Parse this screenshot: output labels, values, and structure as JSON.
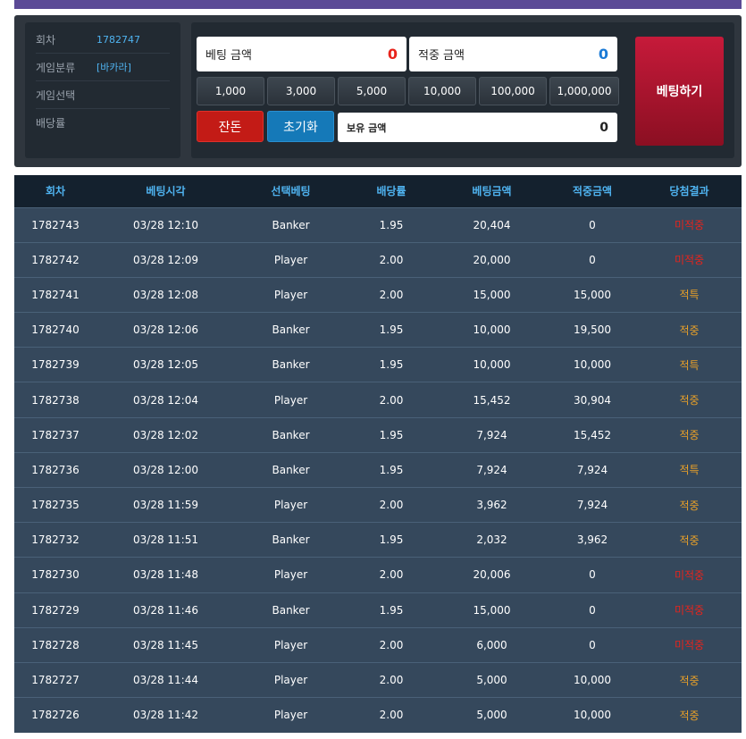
{
  "info": {
    "round_label": "회차",
    "round_value": "1782747",
    "category_label": "게임분류",
    "category_value": "[바카라]",
    "select_label": "게임선택",
    "select_value": "",
    "odds_label": "배당률",
    "odds_value": ""
  },
  "bet": {
    "bet_amount_label": "베팅 금액",
    "bet_amount_value": "0",
    "win_amount_label": "적중 금액",
    "win_amount_value": "0",
    "chips": [
      "1,000",
      "3,000",
      "5,000",
      "10,000",
      "100,000",
      "1,000,000"
    ],
    "balance_button": "잔돈",
    "reset_button": "초기화",
    "hold_label": "보유 금액",
    "hold_value": "0",
    "bet_button": "베팅하기"
  },
  "colors": {
    "accent_blue": "#4fb3f0",
    "miss_red": "#e8241c",
    "hit_orange": "#e8a028",
    "bet_button": "#a8132e"
  },
  "history": {
    "headers": [
      "회차",
      "베팅시각",
      "선택베팅",
      "배당률",
      "베팅금액",
      "적중금액",
      "당첨결과"
    ],
    "rows": [
      [
        "1782743",
        "03/28 12:10",
        "Banker",
        "1.95",
        "20,404",
        "0",
        "미적중"
      ],
      [
        "1782742",
        "03/28 12:09",
        "Player",
        "2.00",
        "20,000",
        "0",
        "미적중"
      ],
      [
        "1782741",
        "03/28 12:08",
        "Player",
        "2.00",
        "15,000",
        "15,000",
        "적특"
      ],
      [
        "1782740",
        "03/28 12:06",
        "Banker",
        "1.95",
        "10,000",
        "19,500",
        "적중"
      ],
      [
        "1782739",
        "03/28 12:05",
        "Banker",
        "1.95",
        "10,000",
        "10,000",
        "적특"
      ],
      [
        "1782738",
        "03/28 12:04",
        "Player",
        "2.00",
        "15,452",
        "30,904",
        "적중"
      ],
      [
        "1782737",
        "03/28 12:02",
        "Banker",
        "1.95",
        "7,924",
        "15,452",
        "적중"
      ],
      [
        "1782736",
        "03/28 12:00",
        "Banker",
        "1.95",
        "7,924",
        "7,924",
        "적특"
      ],
      [
        "1782735",
        "03/28 11:59",
        "Player",
        "2.00",
        "3,962",
        "7,924",
        "적중"
      ],
      [
        "1782732",
        "03/28 11:51",
        "Banker",
        "1.95",
        "2,032",
        "3,962",
        "적중"
      ],
      [
        "1782730",
        "03/28 11:48",
        "Player",
        "2.00",
        "20,006",
        "0",
        "미적중"
      ],
      [
        "1782729",
        "03/28 11:46",
        "Banker",
        "1.95",
        "15,000",
        "0",
        "미적중"
      ],
      [
        "1782728",
        "03/28 11:45",
        "Player",
        "2.00",
        "6,000",
        "0",
        "미적중"
      ],
      [
        "1782727",
        "03/28 11:44",
        "Player",
        "2.00",
        "5,000",
        "10,000",
        "적중"
      ],
      [
        "1782726",
        "03/28 11:42",
        "Player",
        "2.00",
        "5,000",
        "10,000",
        "적중"
      ]
    ]
  }
}
